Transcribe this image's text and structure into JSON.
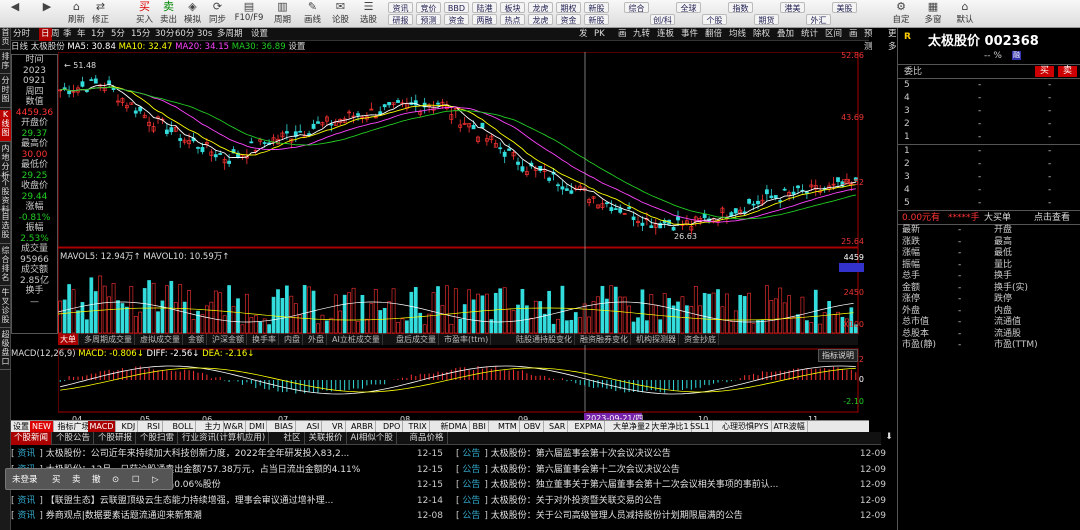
{
  "toolbar": {
    "items": [
      "Back",
      "Forward",
      "Refresh",
      "Revise",
      "Buy",
      "Sell",
      "Simulate",
      "Sync",
      "F10/F9",
      "Period",
      "Draw",
      "Argue",
      "Select"
    ],
    "grid": [
      [
        "资讯",
        "竞价",
        "BBD",
        "陆港",
        "板块",
        "龙虎",
        "期权",
        "新股"
      ],
      [
        "研报",
        "预测",
        "资金",
        "两融",
        "热点",
        "龙虎",
        "资金",
        "新股"
      ]
    ],
    "right": [
      "综合",
      "创/科",
      "全球",
      "个股",
      "指数",
      "期货",
      "港美",
      "外汇",
      "美股"
    ],
    "items_cn": [
      "",
      "",
      "刷新",
      "修正",
      "买入",
      "卖出",
      "模拟",
      "同步",
      "F10/F9",
      "周期",
      "画线",
      "论股",
      "选股"
    ],
    "extra": [
      "自定",
      "多窗",
      "默认"
    ]
  },
  "left_tabs": [
    "首页",
    "排序",
    "分时图",
    "K线图",
    "内地分析",
    "个股资料",
    "自选股",
    "综合排名",
    "牛叉诊股",
    "超级盘口"
  ],
  "periods": [
    "分时",
    "日",
    "周",
    "季",
    "年",
    "1分",
    "5分",
    "15分",
    "30分",
    "60分",
    "30s",
    "多周期",
    "设置"
  ],
  "period_tools": [
    "发",
    "PK",
    "画",
    "九转",
    "连板",
    "事件",
    "翻倍",
    "均线",
    "除权",
    "叠加",
    "统计",
    "区间",
    "画",
    "预测",
    "更多"
  ],
  "ma": {
    "label": "日线 太极股份",
    "ma5": "MA5: 30.84",
    "ma10": "MA10: 32.47",
    "ma20": "MA20: 34.15",
    "ma30": "MA30: 36.89",
    "colors": {
      "ma5": "#ffffff",
      "ma10": "#ffff00",
      "ma20": "#ff44ff",
      "ma30": "#22cc22"
    }
  },
  "info": {
    "items": [
      [
        "时间",
        "g"
      ],
      [
        "2023",
        "g"
      ],
      [
        "0921",
        "g"
      ],
      [
        "周四",
        "g"
      ],
      [
        "数值",
        "g"
      ],
      [
        "4459.36",
        "r"
      ],
      [
        "开盘价",
        "g"
      ],
      [
        "29.37",
        "gr"
      ],
      [
        "最高价",
        "g"
      ],
      [
        "30.00",
        "r"
      ],
      [
        "最低价",
        "g"
      ],
      [
        "29.25",
        "gr"
      ],
      [
        "收盘价",
        "g"
      ],
      [
        "29.44",
        "gr"
      ],
      [
        "涨幅",
        "g"
      ],
      [
        "-0.81%",
        "gr"
      ],
      [
        "振幅",
        "g"
      ],
      [
        "2.53%",
        "gr"
      ],
      [
        "成交量",
        "g"
      ],
      [
        "95966",
        "g"
      ],
      [
        "成交额",
        "g"
      ],
      [
        "2.85亿",
        "g"
      ],
      [
        "换手",
        "g"
      ],
      [
        "—",
        "g"
      ]
    ]
  },
  "price_axis": [
    "52.86",
    "43.69",
    "34.52",
    "25.64"
  ],
  "hl_labels": {
    "high": "51.48",
    "low": "26.63"
  },
  "vol": {
    "label": "MAVOL5: 12.94万↑  MAVOL10: 10.59万↑",
    "axis": [
      "4459",
      "2450",
      "X100"
    ]
  },
  "subtabs": [
    "大单",
    "多周期成交量",
    "虚拟成交量",
    "金额",
    "沪深金额",
    "换手率",
    "内盘",
    "外盘",
    "AI立桩成交量",
    "盘后成交量",
    "市盈率(ttm)",
    "陆股通持股变化",
    "融资融券变化",
    "机构探测器",
    "资金抄底"
  ],
  "macd": {
    "label": "MACD(12,26,9)",
    "macd": "MACD: -0.806↓",
    "diff": "DIFF: -2.56↓",
    "dea": "DEA: -2.16↓",
    "axis": [
      "1.72",
      "0",
      "-2.10"
    ],
    "help": "指标说明"
  },
  "months": [
    "04",
    "05",
    "06",
    "07",
    "08",
    "09",
    "10",
    "11",
    "12"
  ],
  "date_tip": "2023-09-21/四",
  "bottom_tabs": [
    "设置",
    "NEW",
    "指标广场",
    "MACD",
    "KDJ",
    "RSI",
    "BOLL",
    "主力",
    "W&R",
    "DMI",
    "BIAS",
    "ASI",
    "VR",
    "ARBR",
    "DPO",
    "TRIX",
    "新DMA",
    "BBI",
    "MTM",
    "OBV",
    "SAR",
    "EXPMA",
    "大单净量2",
    "大单净比1",
    "SSL1",
    "心理恐惧PYS",
    "ATR波幅"
  ],
  "news_tabs": [
    "个股新闻",
    "个股公告",
    "个股研报",
    "个股扫雷",
    "行业资讯(计算机应用)",
    "社区",
    "关联报价",
    "AI相似个股",
    "商品价格"
  ],
  "news_left": [
    [
      "资讯",
      "太极股份：公司近年来持续加大科技创新力度，2022年全年研发投入83,2...",
      "12-15"
    ],
    [
      "资讯",
      "太极股份：12月…日获沪股通卖出金额757.38万元，占当日流出金额的4.11%",
      "12-15"
    ],
    [
      "资讯",
      "太极股份：12月…日获外资卖出0.06%股份",
      "12-15"
    ],
    [
      "资讯",
      "【联盟生态】云联盟顶级云生态能力持续增强，理事会审议通过增补理...",
      "12-14"
    ],
    [
      "资讯",
      "券商观点|数据要素话题流通迎来新策潮",
      "12-08"
    ]
  ],
  "news_right": [
    [
      "公告",
      "太极股份：第六届监事会第十次会议决议公告",
      "12-09"
    ],
    [
      "公告",
      "太极股份：第六届董事会第十二次会议决议公告",
      "12-09"
    ],
    [
      "公告",
      "太极股份：独立董事关于第六届董事会第十二次会议相关事项的事前认...",
      "12-09"
    ],
    [
      "公告",
      "太极股份：关于对外投资暨关联交易的公告",
      "12-09"
    ],
    [
      "公告",
      "太极股份：关于公司高级管理人员减持股份计划期限届满的公告",
      "12-09"
    ]
  ],
  "popup": [
    "未登录",
    "买",
    "卖",
    "撤",
    "⊙",
    "☐",
    "▷"
  ],
  "right": {
    "code": "R",
    "name": "太极股价 002368",
    "pct": "-- %",
    "badge": "融",
    "ratio": "委比",
    "buy": "买",
    "sell": "卖",
    "qty": "0.00元有",
    "star": "*****手",
    "big": "大买单",
    "check": "点击查看",
    "sell_rows": [
      "5",
      "4",
      "3",
      "2",
      "1"
    ],
    "buy_rows": [
      "1",
      "2",
      "3",
      "4",
      "5"
    ],
    "labels": [
      [
        "最新",
        "开盘"
      ],
      [
        "涨跌",
        "最高"
      ],
      [
        "涨幅",
        "最低"
      ],
      [
        "振幅",
        "量比"
      ],
      [
        "总手",
        "换手"
      ],
      [
        "金额",
        "换手(实)"
      ],
      [
        "涨停",
        "跌停"
      ],
      [
        "外盘",
        "内盘"
      ],
      [
        "总市值",
        "流通值"
      ],
      [
        "总股本",
        "流通股"
      ],
      [
        "市盈(静)",
        "市盈(TTM)"
      ]
    ]
  }
}
